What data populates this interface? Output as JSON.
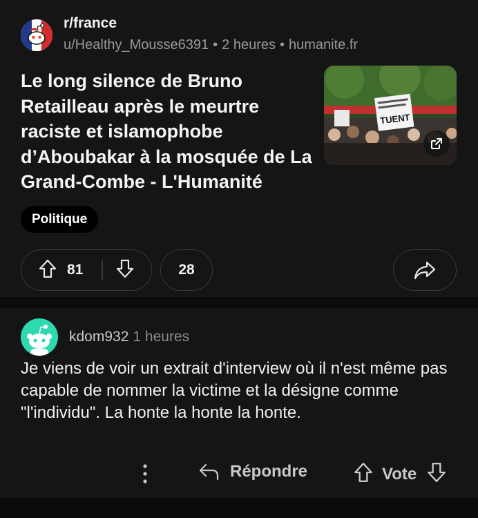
{
  "post": {
    "subreddit": "r/france",
    "author": "u/Healthy_Mousse6391",
    "time": "2 heures",
    "domain": "humanite.fr",
    "title": "Le long silence de Bruno Retailleau après le meurtre raciste et islamophobe d’Aboubakar à la mosquée de La Grand-Combe - L'Humanité",
    "thumbnail_sign_text": "TUENT",
    "flair": "Politique",
    "score": "81",
    "comments_count": "28"
  },
  "comment": {
    "username": "kdom932",
    "time": "1 heures",
    "body": "Je viens de voir un extrait d'interview où il n'est même pas capable de nommer la victime et la désigne comme \"l'individu\". La honte la honte la honte.",
    "reply_label": "Répondre",
    "vote_label": "Vote"
  },
  "colors": {
    "background": "#0b0b0b",
    "card": "#151515",
    "comment_avatar": "#2fd9b0",
    "muted_text": "#9a9a9a"
  }
}
